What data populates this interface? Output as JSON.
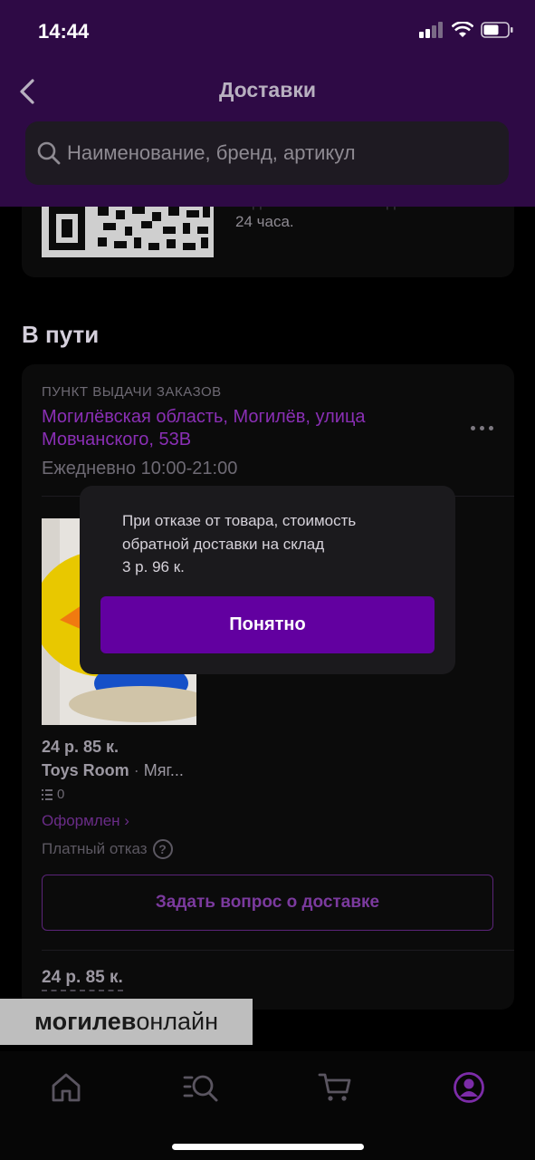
{
  "status_bar": {
    "time": "14:44"
  },
  "header": {
    "title": "Доставки",
    "search_placeholder": "Наименование, бренд, артикул"
  },
  "qr_card": {
    "text_line1": "Код обновляется каждые",
    "text_line2": "24 часа."
  },
  "section": {
    "title": "В пути"
  },
  "order": {
    "pickup_label": "ПУНКТ ВЫДАЧИ ЗАКАЗОВ",
    "address": "Могилёвская область, Могилёв, улица Мовчанского, 53В",
    "hours": "Ежедневно 10:00-21:00",
    "product": {
      "price": "24 р. 85 к.",
      "brand": "Toys Room",
      "separator": "·",
      "name_truncated": "Мяг...",
      "reviews_count": "0",
      "status": "Оформлен ›",
      "paid_refusal": "Платный отказ"
    },
    "ask_button": "Задать вопрос о доставке",
    "total_price": "24 р. 85 к."
  },
  "popup": {
    "line1": "При отказе от товара, стоимость",
    "line2": "обратной доставки на склад",
    "line3": "3 р. 96 к.",
    "button": "Понятно"
  },
  "watermark": {
    "bold": "могилев",
    "normal": "онлайн"
  },
  "tab_bar": {
    "active_tab": "profile",
    "tabs": [
      "home-icon",
      "catalog-search-icon",
      "cart-icon",
      "profile-icon"
    ]
  },
  "colors": {
    "header_bg": "#2e0a45",
    "accent_purple": "#6200a0",
    "link_purple": "#8a2fb5",
    "card_bg": "#0b0b0b",
    "popup_bg": "#1b1a1d"
  }
}
